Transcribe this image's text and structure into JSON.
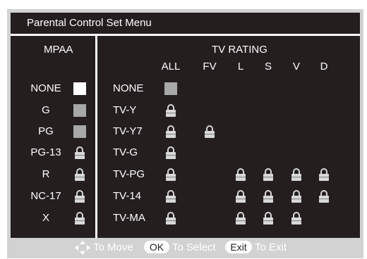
{
  "menu": {
    "title": "Parental Control Set Menu"
  },
  "mpaa": {
    "header": "MPAA",
    "rows": [
      {
        "label": "NONE",
        "state": "selected"
      },
      {
        "label": "G",
        "state": "unlocked"
      },
      {
        "label": "PG",
        "state": "unlocked"
      },
      {
        "label": "PG-13",
        "state": "locked"
      },
      {
        "label": "R",
        "state": "locked"
      },
      {
        "label": "NC-17",
        "state": "locked"
      },
      {
        "label": "X",
        "state": "locked"
      }
    ]
  },
  "tv_rating": {
    "header": "TV RATING",
    "columns": [
      "ALL",
      "FV",
      "L",
      "S",
      "V",
      "D"
    ],
    "rows": [
      {
        "label": "NONE",
        "cells": [
          "box",
          "",
          "",
          "",
          "",
          ""
        ]
      },
      {
        "label": "TV-Y",
        "cells": [
          "lock",
          "",
          "",
          "",
          "",
          ""
        ]
      },
      {
        "label": "TV-Y7",
        "cells": [
          "lock",
          "lock",
          "",
          "",
          "",
          ""
        ]
      },
      {
        "label": "TV-G",
        "cells": [
          "lock",
          "",
          "",
          "",
          "",
          ""
        ]
      },
      {
        "label": "TV-PG",
        "cells": [
          "lock",
          "",
          "lock",
          "lock",
          "lock",
          "lock"
        ]
      },
      {
        "label": "TV-14",
        "cells": [
          "lock",
          "",
          "lock",
          "lock",
          "lock",
          "lock"
        ]
      },
      {
        "label": "TV-MA",
        "cells": [
          "lock",
          "",
          "lock",
          "lock",
          "lock",
          ""
        ]
      }
    ]
  },
  "footer": {
    "move_icon": "four-way-arrow-icon",
    "move_label": "To Move",
    "ok_key": "OK",
    "select_label": "To Select",
    "exit_key": "Exit",
    "exit_label": "To Exit"
  },
  "colors": {
    "background": "#241e1f",
    "frame": "#d2d2d2",
    "text": "#ffffff",
    "unlocked_box": "#a8a8a8",
    "selected_box": "#ffffff"
  }
}
